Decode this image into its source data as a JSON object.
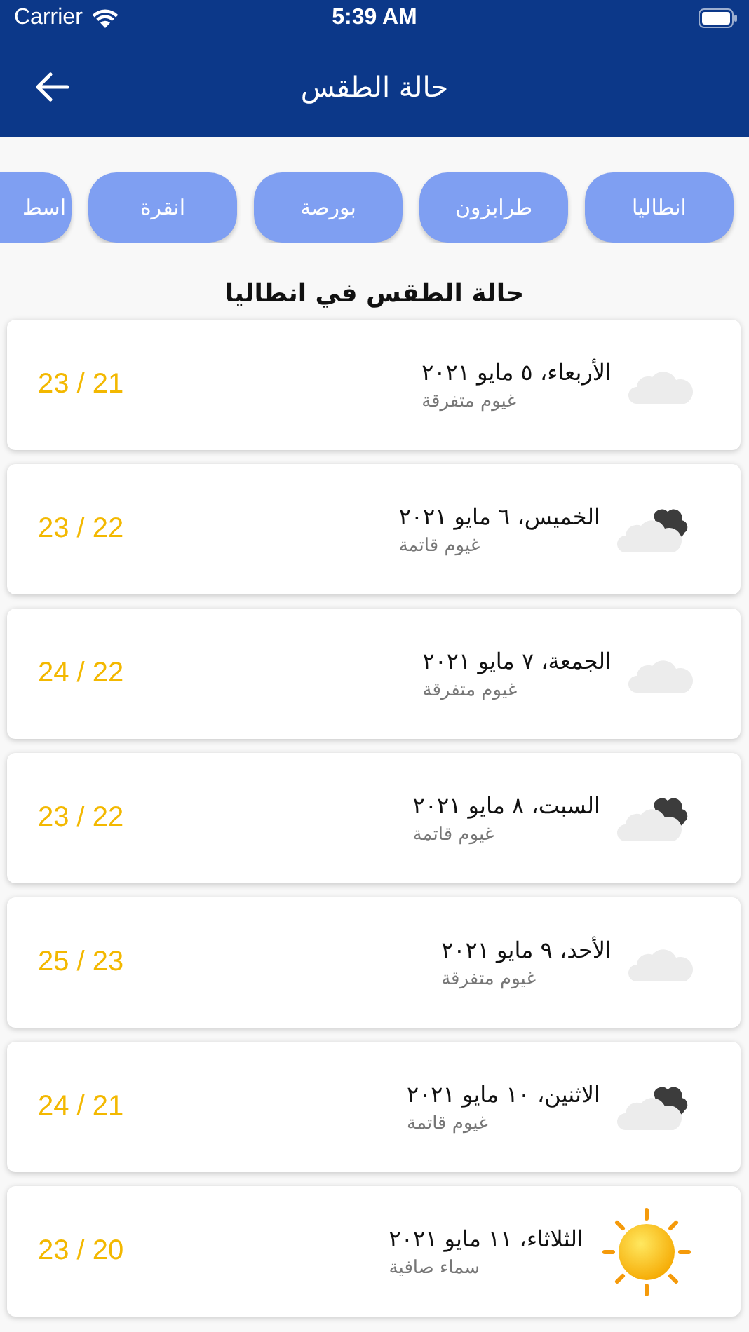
{
  "status_bar": {
    "carrier": "Carrier",
    "time": "5:39 AM"
  },
  "header": {
    "title": "حالة الطقس"
  },
  "cities": [
    {
      "label": "انطاليا",
      "selected": false
    },
    {
      "label": "طرابزون",
      "selected": false
    },
    {
      "label": "بورصة",
      "selected": false
    },
    {
      "label": "انقرة",
      "selected": false
    },
    {
      "label": "اسط",
      "selected": false,
      "cut": true
    }
  ],
  "section_title": "حالة الطقس في انطاليا",
  "days": [
    {
      "date": "الأربعاء، ٥ مايو ٢٠٢١",
      "condition": "غيوم متفرقة",
      "temps": "23 / 21",
      "kind": "scattered"
    },
    {
      "date": "الخميس، ٦ مايو ٢٠٢١",
      "condition": "غيوم قاتمة",
      "temps": "23 / 22",
      "kind": "overcast"
    },
    {
      "date": "الجمعة، ٧ مايو ٢٠٢١",
      "condition": "غيوم متفرقة",
      "temps": "24 / 22",
      "kind": "scattered"
    },
    {
      "date": "السبت، ٨ مايو ٢٠٢١",
      "condition": "غيوم قاتمة",
      "temps": "23 / 22",
      "kind": "overcast"
    },
    {
      "date": "الأحد، ٩ مايو ٢٠٢١",
      "condition": "غيوم متفرقة",
      "temps": "25 / 23",
      "kind": "scattered"
    },
    {
      "date": "الاثنين، ١٠ مايو ٢٠٢١",
      "condition": "غيوم قاتمة",
      "temps": "24 / 21",
      "kind": "overcast"
    },
    {
      "date": "الثلاثاء، ١١ مايو ٢٠٢١",
      "condition": "سماء صافية",
      "temps": "23 / 20",
      "kind": "clear"
    }
  ]
}
